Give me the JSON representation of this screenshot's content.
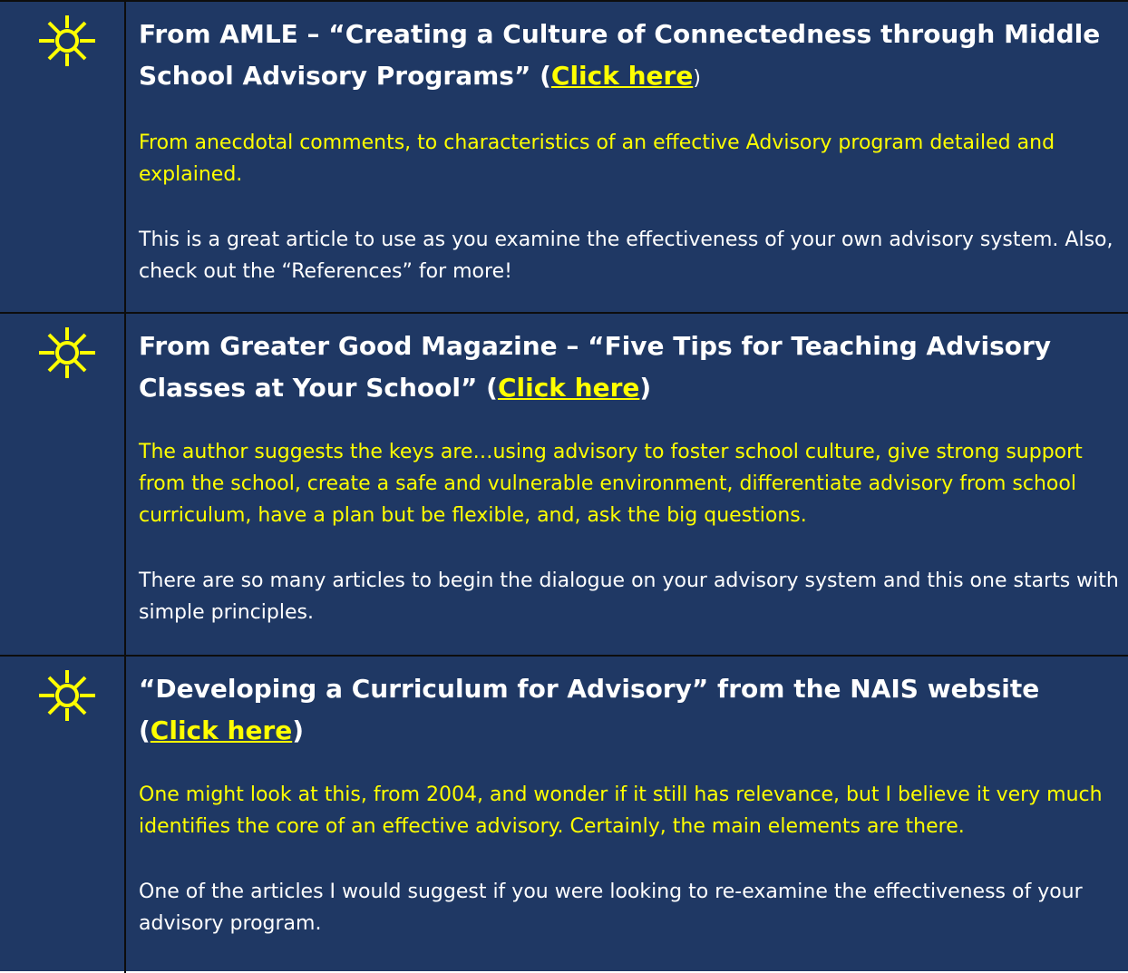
{
  "colors": {
    "background": "#1f3864",
    "accent": "#ffff00",
    "text": "#ffffff",
    "border": "#0d0d0d"
  },
  "rows": [
    {
      "icon": "sun-icon",
      "heading": "From AMLE – “Creating a Culture of Connectedness through Middle School Advisory Programs” (",
      "link_label": "Click here",
      "heading_close": ")",
      "summary": "From anecdotal comments, to characteristics of an effective Advisory program detailed and explained.",
      "comment": "This is a great article to use as you examine the effectiveness of your own advisory system. Also, check out the “References” for more!"
    },
    {
      "icon": "sun-icon",
      "heading": "From Greater Good Magazine – “Five Tips for Teaching Advisory Classes at Your School” (",
      "link_label": "Click here",
      "heading_close": ")",
      "summary": "The author suggests the keys are…using advisory to foster school culture, give strong support from the school, create a safe and vulnerable environment, differentiate advisory from school curriculum, have a plan but be flexible, and, ask the big questions.",
      "comment": "There are so many articles to begin the dialogue on your advisory system and this one starts with simple principles."
    },
    {
      "icon": "sun-icon",
      "heading": "“Developing a Curriculum for Advisory” from the NAIS website (",
      "link_label": "Click here",
      "heading_close": ")",
      "summary": "One might look at this, from 2004, and wonder if it still has relevance, but I believe it very much identifies the core of an effective advisory. Certainly, the main elements are there.",
      "comment": "One of the articles I would suggest if you were looking to re-examine the effectiveness of your advisory program."
    }
  ]
}
